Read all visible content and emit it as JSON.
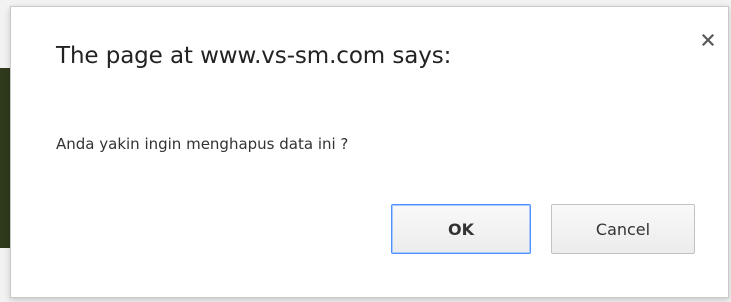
{
  "dialog": {
    "title": "The page at www.vs-sm.com says:",
    "message": "Anda yakin ingin menghapus data ini ?",
    "close_icon": "close-icon",
    "buttons": {
      "ok_label": "OK",
      "cancel_label": "Cancel"
    }
  },
  "colors": {
    "focus_border": "#4d90fe",
    "backdrop_dark": "#2f3a1c"
  }
}
